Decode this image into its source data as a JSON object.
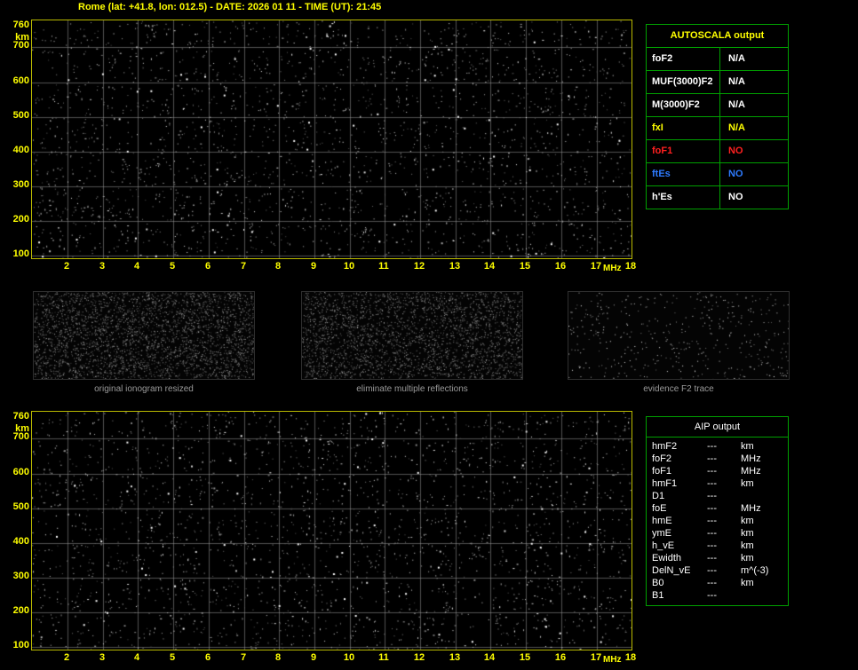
{
  "title": "Rome (lat: +41.8, lon: 012.5) - DATE: 2026 01 11 - TIME (UT): 21:45",
  "colors": {
    "background": "#000000",
    "axis_yellow": "#ffff00",
    "plot_border": "#b9b900",
    "table_border": "#00a000",
    "white": "#ffffff",
    "red": "#ff2020",
    "blue": "#2e7bff",
    "caption_gray": "#9a9a9a"
  },
  "ionogram": {
    "x_unit": "MHz",
    "y_unit": "km",
    "x_ticks": [
      "2",
      "3",
      "4",
      "5",
      "6",
      "7",
      "8",
      "9",
      "10",
      "11",
      "12",
      "13",
      "14",
      "15",
      "16",
      "17",
      "18"
    ],
    "y_ticks": [
      "760",
      "700",
      "600",
      "500",
      "400",
      "300",
      "200",
      "100"
    ],
    "x_range_mhz": [
      1,
      18
    ],
    "y_range_km": [
      90,
      778
    ],
    "content": "background noise speckle only, no echo traces detected"
  },
  "autoscala_table": {
    "header": "AUTOSCALA output",
    "rows": [
      {
        "label": "foF2",
        "value": "N/A",
        "color": "#ffffff"
      },
      {
        "label": "MUF(3000)F2",
        "value": "N/A",
        "color": "#ffffff"
      },
      {
        "label": "M(3000)F2",
        "value": "N/A",
        "color": "#ffffff"
      },
      {
        "label": "fxI",
        "value": "N/A",
        "color": "#ffff00"
      },
      {
        "label": "foF1",
        "value": "NO",
        "color": "#ff2020"
      },
      {
        "label": "ftEs",
        "value": "NO",
        "color": "#2e7bff"
      },
      {
        "label": "h'Es",
        "value": "NO",
        "color": "#ffffff"
      }
    ]
  },
  "panels": [
    {
      "caption": "original ionogram resized"
    },
    {
      "caption": "eliminate multiple reflections"
    },
    {
      "caption": "evidence F2 trace"
    }
  ],
  "aip_table": {
    "header": "AIP output",
    "rows": [
      {
        "label": "hmF2",
        "value": "---",
        "unit": "km"
      },
      {
        "label": "foF2",
        "value": "---",
        "unit": "MHz"
      },
      {
        "label": "foF1",
        "value": "---",
        "unit": "MHz"
      },
      {
        "label": "hmF1",
        "value": "---",
        "unit": "km"
      },
      {
        "label": "D1",
        "value": "---",
        "unit": ""
      },
      {
        "label": "foE",
        "value": "---",
        "unit": "MHz"
      },
      {
        "label": "hmE",
        "value": "---",
        "unit": "km"
      },
      {
        "label": "ymE",
        "value": "---",
        "unit": "km"
      },
      {
        "label": "h_vE",
        "value": "---",
        "unit": "km"
      },
      {
        "label": "Ewidth",
        "value": "---",
        "unit": "km"
      },
      {
        "label": "DelN_vE",
        "value": "---",
        "unit": "m^(-3)"
      },
      {
        "label": "B0",
        "value": "---",
        "unit": "km"
      },
      {
        "label": "B1",
        "value": "---",
        "unit": ""
      }
    ]
  }
}
